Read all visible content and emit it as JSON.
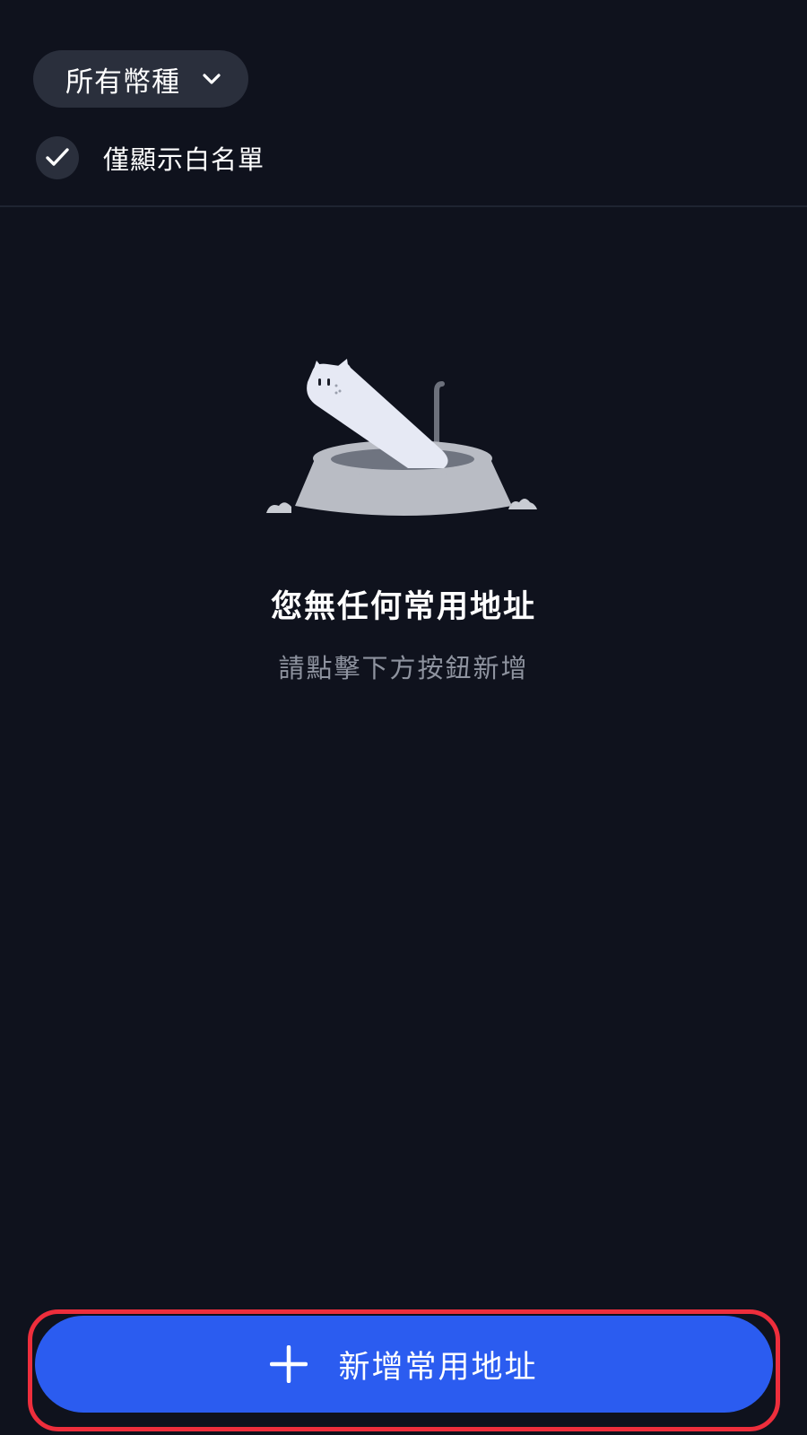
{
  "filter": {
    "coin_dropdown_label": "所有幣種",
    "whitelist_label": "僅顯示白名單",
    "whitelist_checked": true,
    "icons": {
      "dropdown": "chevron-down-icon",
      "check": "check-icon"
    }
  },
  "empty_state": {
    "illustration": "cat-in-bowl-illustration",
    "title": "您無任何常用地址",
    "subtitle": "請點擊下方按鈕新增"
  },
  "add_button": {
    "label": "新增常用地址",
    "icon": "plus-icon",
    "highlighted": true
  },
  "colors": {
    "background": "#0f121d",
    "pill": "#2a2f3c",
    "primary": "#2b5cf0",
    "highlight": "#ee2e3c",
    "muted_text": "#8e939f"
  }
}
